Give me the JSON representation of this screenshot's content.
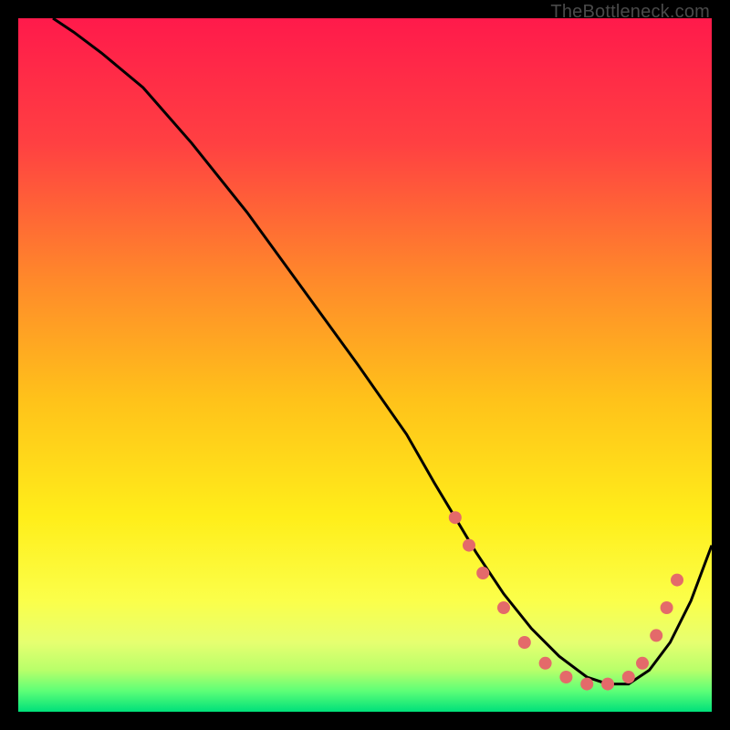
{
  "watermark": "TheBottleneck.com",
  "chart_data": {
    "type": "line",
    "title": "",
    "xlabel": "",
    "ylabel": "",
    "xlim": [
      0,
      100
    ],
    "ylim": [
      0,
      100
    ],
    "grid": false,
    "legend": false,
    "background_gradient": {
      "stops": [
        {
          "offset": 0.0,
          "color": "#ff1a4b"
        },
        {
          "offset": 0.18,
          "color": "#ff4042"
        },
        {
          "offset": 0.38,
          "color": "#ff8a2a"
        },
        {
          "offset": 0.55,
          "color": "#ffc21a"
        },
        {
          "offset": 0.72,
          "color": "#ffee1a"
        },
        {
          "offset": 0.84,
          "color": "#fbff4a"
        },
        {
          "offset": 0.9,
          "color": "#e6ff70"
        },
        {
          "offset": 0.94,
          "color": "#b8ff6a"
        },
        {
          "offset": 0.97,
          "color": "#5dff77"
        },
        {
          "offset": 1.0,
          "color": "#00e07a"
        }
      ]
    },
    "series": [
      {
        "name": "bottleneck-curve",
        "color": "#000000",
        "x": [
          5,
          8,
          12,
          18,
          25,
          33,
          41,
          49,
          56,
          60,
          63,
          66,
          70,
          74,
          78,
          82,
          85,
          88,
          91,
          94,
          97,
          100
        ],
        "y": [
          100,
          98,
          95,
          90,
          82,
          72,
          61,
          50,
          40,
          33,
          28,
          23,
          17,
          12,
          8,
          5,
          4,
          4,
          6,
          10,
          16,
          24
        ]
      }
    ],
    "markers": {
      "name": "highlight-dots",
      "color": "#e46a6a",
      "radius": 7,
      "points": [
        {
          "x": 63,
          "y": 28
        },
        {
          "x": 65,
          "y": 24
        },
        {
          "x": 67,
          "y": 20
        },
        {
          "x": 70,
          "y": 15
        },
        {
          "x": 73,
          "y": 10
        },
        {
          "x": 76,
          "y": 7
        },
        {
          "x": 79,
          "y": 5
        },
        {
          "x": 82,
          "y": 4
        },
        {
          "x": 85,
          "y": 4
        },
        {
          "x": 88,
          "y": 5
        },
        {
          "x": 90,
          "y": 7
        },
        {
          "x": 92,
          "y": 11
        },
        {
          "x": 93.5,
          "y": 15
        },
        {
          "x": 95,
          "y": 19
        }
      ]
    }
  }
}
